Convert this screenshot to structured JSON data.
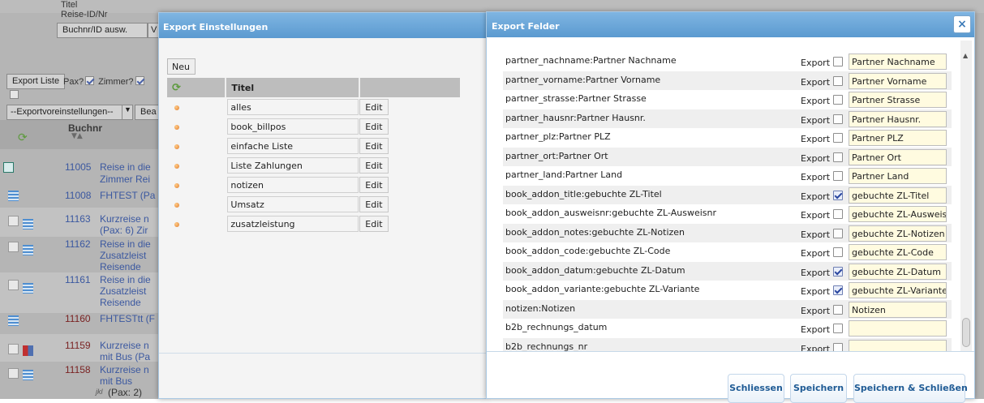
{
  "background": {
    "top_labels": [
      "Titel",
      "Reise-ID/Nr"
    ],
    "buchnr_button": "Buchnr/ID ausw.",
    "v_button": "V",
    "export_liste_button": "Export Liste",
    "pax_label": "Pax?",
    "zimmer_label": "Zimmer?",
    "exportvoreinstellungen_select": "--Exportvoreinstellungen--",
    "bea_button": "Bea",
    "buchnr_header": "Buchnr",
    "rows": [
      {
        "num": "11005",
        "text": "Reise in die",
        "sub": "Zimmer Rei",
        "color": "dark"
      },
      {
        "num": "11008",
        "text": "FHTEST (Pa",
        "sub": "",
        "color": "dark"
      },
      {
        "num": "11163",
        "text": "Kurzreise n",
        "sub": "(Pax: 6) Zir",
        "color": "dark"
      },
      {
        "num": "11162",
        "text": "Reise in die",
        "sub": "Zusatzleist",
        "sub2": "Reisende",
        "color": "dark"
      },
      {
        "num": "11161",
        "text": "Reise in die",
        "sub": "Zusatzleist",
        "sub2": "Reisende",
        "color": "dark"
      },
      {
        "num": "11160",
        "text": "FHTESTtt (F",
        "sub": "",
        "color": "red"
      },
      {
        "num": "11159",
        "text": "Kurzreise n",
        "sub": "mit Bus (Pa",
        "color": "red"
      },
      {
        "num": "11158",
        "text": "Kurzreise n",
        "sub": "mit Bus",
        "sub2": "(Pax: 2)",
        "sub2_prefix": "jkl",
        "color": "red"
      }
    ]
  },
  "export_einstellungen": {
    "title": "Export Einstellungen",
    "neu_button": "Neu",
    "column_title": "Titel",
    "edit_label": "Edit",
    "items": [
      "alles",
      "book_billpos",
      "einfache Liste",
      "Liste Zahlungen",
      "notizen",
      "Umsatz",
      "zusatzleistung"
    ]
  },
  "export_felder": {
    "title": "Export Felder",
    "close_symbol": "×",
    "export_label": "Export",
    "fields": [
      {
        "name": "partner_nachname:Partner Nachname",
        "checked": false,
        "label": "Partner Nachname"
      },
      {
        "name": "partner_vorname:Partner Vorname",
        "checked": false,
        "label": "Partner Vorname"
      },
      {
        "name": "partner_strasse:Partner Strasse",
        "checked": false,
        "label": "Partner Strasse"
      },
      {
        "name": "partner_hausnr:Partner Hausnr.",
        "checked": false,
        "label": "Partner Hausnr."
      },
      {
        "name": "partner_plz:Partner PLZ",
        "checked": false,
        "label": "Partner PLZ"
      },
      {
        "name": "partner_ort:Partner Ort",
        "checked": false,
        "label": "Partner Ort"
      },
      {
        "name": "partner_land:Partner Land",
        "checked": false,
        "label": "Partner Land"
      },
      {
        "name": "book_addon_title:gebuchte ZL-Titel",
        "checked": true,
        "label": "gebuchte ZL-Titel"
      },
      {
        "name": "book_addon_ausweisnr:gebuchte ZL-Ausweisnr",
        "checked": false,
        "label": "gebuchte ZL-Ausweisnr"
      },
      {
        "name": "book_addon_notes:gebuchte ZL-Notizen",
        "checked": false,
        "label": "gebuchte ZL-Notizen"
      },
      {
        "name": "book_addon_code:gebuchte ZL-Code",
        "checked": false,
        "label": "gebuchte ZL-Code"
      },
      {
        "name": "book_addon_datum:gebuchte ZL-Datum",
        "checked": true,
        "label": "gebuchte ZL-Datum"
      },
      {
        "name": "book_addon_variante:gebuchte ZL-Variante",
        "checked": true,
        "label": "gebuchte ZL-Variante"
      },
      {
        "name": "notizen:Notizen",
        "checked": false,
        "label": "Notizen"
      },
      {
        "name": "b2b_rechnungs_datum",
        "checked": false,
        "label": ""
      },
      {
        "name": "b2b_rechnungs_nr",
        "checked": false,
        "label": ""
      }
    ],
    "buttons": {
      "schliessen": "Schliessen",
      "speichern": "Speichern",
      "speichern_schliessen": "Speichern & Schließen"
    }
  },
  "colors": {
    "dialog_title": "#5b9ad0",
    "footer_button_text": "#1f5b95",
    "label_input_bg": "#fffbe0",
    "link_blue": "#3b58a0",
    "booking_red": "#7a2323"
  }
}
